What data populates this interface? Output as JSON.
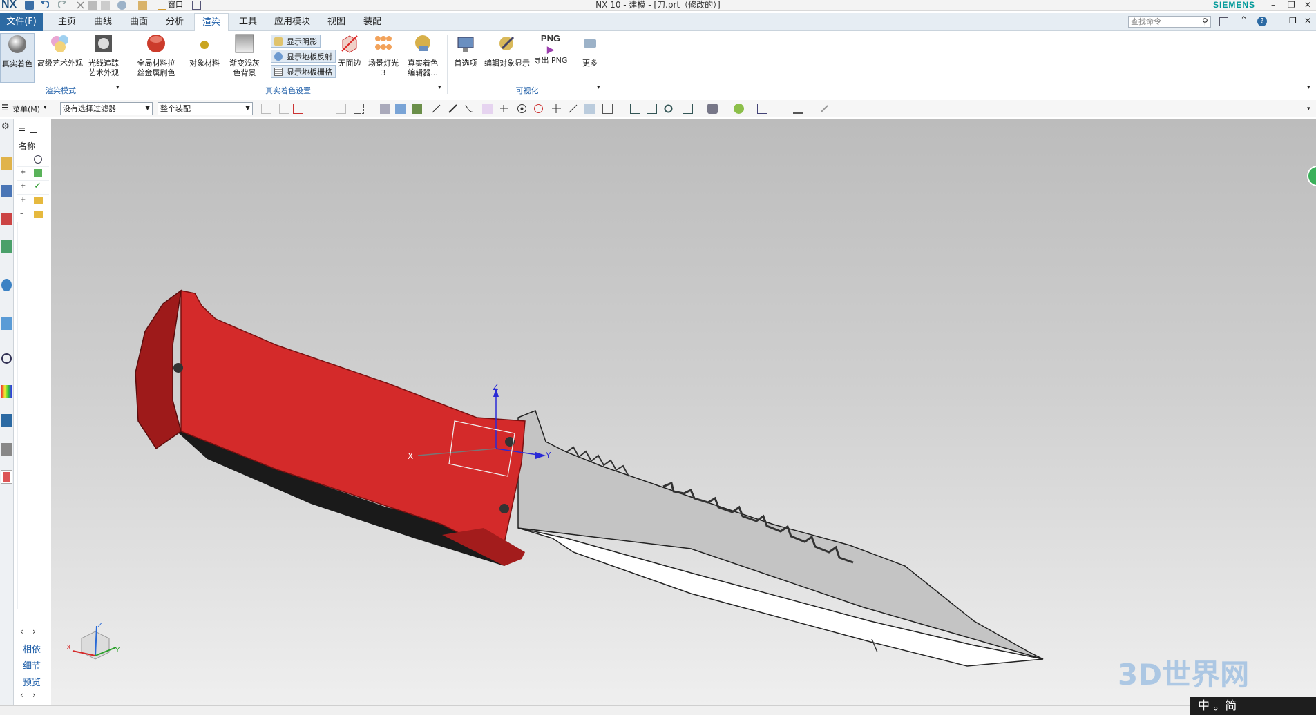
{
  "app": {
    "logo": "NX",
    "title": "NX 10 - 建模 - [刀.prt（修改的）]",
    "brand": "SIEMENS"
  },
  "quick_access": {
    "window_label": "窗口"
  },
  "menubar": {
    "file_label": "文件(F)",
    "tabs": [
      "主页",
      "曲线",
      "曲面",
      "分析",
      "渲染",
      "工具",
      "应用模块",
      "视图",
      "装配"
    ],
    "active_tab": "渲染",
    "search_placeholder": "查找命令"
  },
  "ribbon": {
    "render_mode": {
      "buttons": [
        {
          "label": "真实着色",
          "icon": "sphere-icon"
        },
        {
          "label": "高级艺术外观",
          "icon": "spheres-icon"
        },
        {
          "label": "光线追踪\n艺术外观",
          "icon": "raytrace-icon"
        }
      ],
      "group_label": "渲染模式"
    },
    "shading_settings": {
      "buttons": [
        {
          "label": "全局材料拉\n丝金属刷色",
          "icon": "red-sphere-icon"
        },
        {
          "label": "对象材料",
          "icon": "material-icon"
        },
        {
          "label": "渐变浅灰\n色背景",
          "icon": "background-icon"
        }
      ],
      "toggles": [
        "显示阴影",
        "显示地板反射",
        "显示地板栅格"
      ],
      "buttons2": [
        {
          "label": "无面边",
          "icon": "no-edge-icon"
        },
        {
          "label": "场景灯光 3",
          "icon": "lights-icon"
        },
        {
          "label": "真实着色\n编辑器...",
          "icon": "editor-icon"
        }
      ],
      "group_label": "真实着色设置"
    },
    "visualization": {
      "buttons": [
        {
          "label": "首选项",
          "icon": "preferences-icon"
        },
        {
          "label": "编辑对象显示",
          "icon": "edit-display-icon"
        },
        {
          "label": "导出 PNG",
          "icon": "png-icon"
        },
        {
          "label": "更多",
          "icon": "more-icon"
        }
      ],
      "png_text": "PNG",
      "group_label": "可视化"
    }
  },
  "toolbar2": {
    "menu_label": "菜单(M)",
    "filter_value": "没有选择过滤器",
    "assembly_value": "整个装配"
  },
  "nav_panel": {
    "header": "名称",
    "links": [
      "相依",
      "细节",
      "预览"
    ]
  },
  "viewport": {
    "axis_labels": {
      "x": "X",
      "y": "Y",
      "z": "Z"
    },
    "triad_labels": {
      "x": "X",
      "y": "Y",
      "z": "Z"
    }
  },
  "ime": {
    "text": "中 。简"
  },
  "watermark": {
    "text": "3D世界网"
  },
  "colors": {
    "handle": "#d42a2a",
    "blade": "#c4c4c4",
    "accent": "#1e5ea8",
    "file_tab": "#2c6aa3",
    "brand": "#009999"
  }
}
